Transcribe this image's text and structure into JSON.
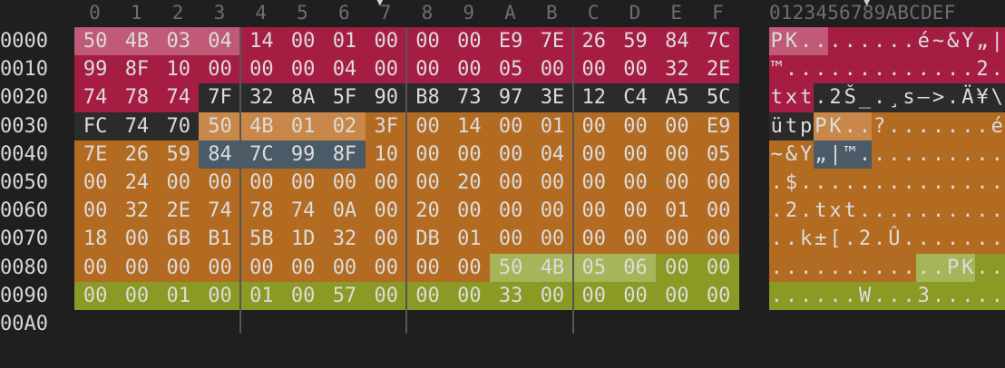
{
  "columns": {
    "hex": [
      "0",
      "1",
      "2",
      "3",
      "4",
      "5",
      "6",
      "7",
      "8",
      "9",
      "A",
      "B",
      "C",
      "D",
      "E",
      "F"
    ],
    "ascii": "0123456789ABCDEF"
  },
  "colors": {
    "header_red": "#a61d44",
    "header_red_hi": "#c05a76",
    "dark_text": "#2b2b2b",
    "orange": "#b36b22",
    "orange_hi": "#c9874a",
    "slate": "#4a5a67",
    "olive": "#8a9a24",
    "olive_hi": "#a6b45a",
    "empty": "#1f1f1f"
  },
  "rows": [
    {
      "offset": "0000",
      "bytes": [
        "50",
        "4B",
        "03",
        "04",
        "14",
        "00",
        "01",
        "00",
        "00",
        "00",
        "E9",
        "7E",
        "26",
        "59",
        "84",
        "7C"
      ],
      "ascii": [
        "P",
        "K",
        ".",
        ".",
        ".",
        ".",
        ".",
        ".",
        ".",
        ".",
        "é",
        "~",
        "&",
        "Y",
        "„",
        "|"
      ],
      "fills": [
        "rh",
        "rh",
        "rh",
        "rh",
        "r",
        "r",
        "r",
        "r",
        "r",
        "r",
        "r",
        "r",
        "r",
        "r",
        "r",
        "r"
      ]
    },
    {
      "offset": "0010",
      "bytes": [
        "99",
        "8F",
        "10",
        "00",
        "00",
        "00",
        "04",
        "00",
        "00",
        "00",
        "05",
        "00",
        "00",
        "00",
        "32",
        "2E"
      ],
      "ascii": [
        "™",
        ".",
        ".",
        ".",
        ".",
        ".",
        ".",
        ".",
        ".",
        ".",
        ".",
        ".",
        ".",
        ".",
        "2",
        "."
      ],
      "fills": [
        "r",
        "r",
        "r",
        "r",
        "r",
        "r",
        "r",
        "r",
        "r",
        "r",
        "r",
        "r",
        "r",
        "r",
        "r",
        "r"
      ]
    },
    {
      "offset": "0020",
      "bytes": [
        "74",
        "78",
        "74",
        "7F",
        "32",
        "8A",
        "5F",
        "90",
        "B8",
        "73",
        "97",
        "3E",
        "12",
        "C4",
        "A5",
        "5C"
      ],
      "ascii": [
        "t",
        "x",
        "t",
        ".",
        "2",
        "Š",
        "_",
        ".",
        "¸",
        "s",
        "—",
        ">",
        ".",
        "Ä",
        "¥",
        "\\"
      ],
      "fills": [
        "r",
        "r",
        "r",
        "d",
        "d",
        "d",
        "d",
        "d",
        "d",
        "d",
        "d",
        "d",
        "d",
        "d",
        "d",
        "d"
      ]
    },
    {
      "offset": "0030",
      "bytes": [
        "FC",
        "74",
        "70",
        "50",
        "4B",
        "01",
        "02",
        "3F",
        "00",
        "14",
        "00",
        "01",
        "00",
        "00",
        "00",
        "E9"
      ],
      "ascii": [
        "ü",
        "t",
        "p",
        "P",
        "K",
        ".",
        ".",
        "?",
        ".",
        ".",
        ".",
        ".",
        ".",
        ".",
        ".",
        "é"
      ],
      "fills": [
        "d",
        "d",
        "d",
        "oh",
        "oh",
        "oh",
        "oh",
        "o",
        "o",
        "o",
        "o",
        "o",
        "o",
        "o",
        "o",
        "o"
      ]
    },
    {
      "offset": "0040",
      "bytes": [
        "7E",
        "26",
        "59",
        "84",
        "7C",
        "99",
        "8F",
        "10",
        "00",
        "00",
        "00",
        "04",
        "00",
        "00",
        "00",
        "05"
      ],
      "ascii": [
        "~",
        "&",
        "Y",
        "„",
        "|",
        "™",
        ".",
        ".",
        ".",
        ".",
        ".",
        ".",
        ".",
        ".",
        ".",
        "."
      ],
      "fills": [
        "o",
        "o",
        "o",
        "s",
        "s",
        "s",
        "s",
        "o",
        "o",
        "o",
        "o",
        "o",
        "o",
        "o",
        "o",
        "o"
      ]
    },
    {
      "offset": "0050",
      "bytes": [
        "00",
        "24",
        "00",
        "00",
        "00",
        "00",
        "00",
        "00",
        "00",
        "20",
        "00",
        "00",
        "00",
        "00",
        "00",
        "00"
      ],
      "ascii": [
        ".",
        "$",
        ".",
        ".",
        ".",
        ".",
        ".",
        ".",
        ".",
        ".",
        ".",
        ".",
        ".",
        ".",
        ".",
        "."
      ],
      "fills": [
        "o",
        "o",
        "o",
        "o",
        "o",
        "o",
        "o",
        "o",
        "o",
        "o",
        "o",
        "o",
        "o",
        "o",
        "o",
        "o"
      ]
    },
    {
      "offset": "0060",
      "bytes": [
        "00",
        "32",
        "2E",
        "74",
        "78",
        "74",
        "0A",
        "00",
        "20",
        "00",
        "00",
        "00",
        "00",
        "00",
        "01",
        "00"
      ],
      "ascii": [
        ".",
        "2",
        ".",
        "t",
        "x",
        "t",
        ".",
        ".",
        ".",
        ".",
        ".",
        ".",
        ".",
        ".",
        ".",
        "."
      ],
      "fills": [
        "o",
        "o",
        "o",
        "o",
        "o",
        "o",
        "o",
        "o",
        "o",
        "o",
        "o",
        "o",
        "o",
        "o",
        "o",
        "o"
      ]
    },
    {
      "offset": "0070",
      "bytes": [
        "18",
        "00",
        "6B",
        "B1",
        "5B",
        "1D",
        "32",
        "00",
        "DB",
        "01",
        "00",
        "00",
        "00",
        "00",
        "00",
        "00"
      ],
      "ascii": [
        ".",
        ".",
        "k",
        "±",
        "[",
        ".",
        "2",
        ".",
        "Û",
        ".",
        ".",
        ".",
        ".",
        ".",
        ".",
        "."
      ],
      "fills": [
        "o",
        "o",
        "o",
        "o",
        "o",
        "o",
        "o",
        "o",
        "o",
        "o",
        "o",
        "o",
        "o",
        "o",
        "o",
        "o"
      ]
    },
    {
      "offset": "0080",
      "bytes": [
        "00",
        "00",
        "00",
        "00",
        "00",
        "00",
        "00",
        "00",
        "00",
        "00",
        "50",
        "4B",
        "05",
        "06",
        "00",
        "00"
      ],
      "ascii": [
        ".",
        ".",
        ".",
        ".",
        ".",
        ".",
        ".",
        ".",
        ".",
        ".",
        ".",
        ".",
        "P",
        "K",
        ".",
        "."
      ],
      "fills": [
        "o",
        "o",
        "o",
        "o",
        "o",
        "o",
        "o",
        "o",
        "o",
        "o",
        "gh",
        "gh",
        "gh",
        "gh",
        "g",
        "g"
      ]
    },
    {
      "offset": "0090",
      "bytes": [
        "00",
        "00",
        "01",
        "00",
        "01",
        "00",
        "57",
        "00",
        "00",
        "00",
        "33",
        "00",
        "00",
        "00",
        "00",
        "00"
      ],
      "ascii": [
        ".",
        ".",
        ".",
        ".",
        ".",
        ".",
        "W",
        ".",
        ".",
        ".",
        "3",
        ".",
        ".",
        ".",
        ".",
        "."
      ],
      "fills": [
        "g",
        "g",
        "g",
        "g",
        "g",
        "g",
        "g",
        "g",
        "g",
        "g",
        "g",
        "g",
        "g",
        "g",
        "g",
        "g"
      ]
    },
    {
      "offset": "00A0",
      "bytes": [],
      "ascii": [],
      "fills": []
    }
  ]
}
